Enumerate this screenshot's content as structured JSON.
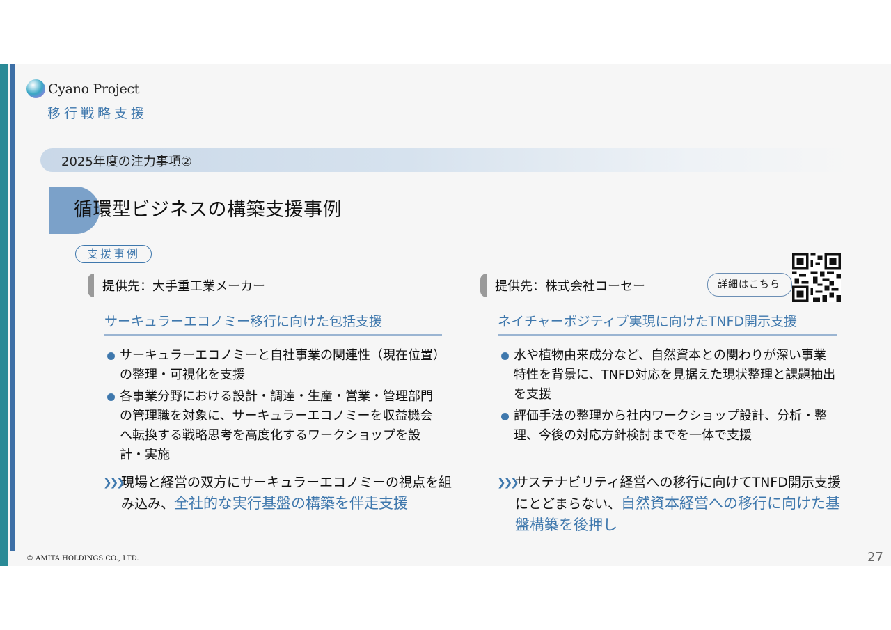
{
  "header": {
    "logo_text": "Cyano Project",
    "subtitle": "移行戦略支援"
  },
  "banner": {
    "text": "2025年度の注力事項②"
  },
  "title": "循環型ビジネスの構築支援事例",
  "section_pill": "支援事例",
  "left": {
    "client": "提供先：大手重工業メーカー",
    "heading": "サーキュラーエコノミー移行に向けた包括支援",
    "bullets": [
      "サーキュラーエコノミーと自社事業の関連性（現在位置）の整理・可視化を支援",
      "各事業分野における設計・調達・生産・営業・管理部門の管理職を対象に、サーキュラーエコノミーを収益機会へ転換する戦略思考を高度化するワークショップを設計・実施"
    ],
    "summary_plain": "現場と経営の双方にサーキュラーエコノミーの視点を組み込み、",
    "summary_highlight": "全社的な実行基盤の構築を伴走支援"
  },
  "right": {
    "client": "提供先：株式会社コーセー",
    "heading": "ネイチャーポジティブ実現に向けたTNFD開示支援",
    "bullets": [
      "水や植物由来成分など、自然資本との関わりが深い事業特性を背景に、TNFD対応を見据えた現状整理と課題抽出を支援",
      "評価手法の整理から社内ワークショップ設計、分析・整理、今後の対応方針検討までを一体で支援"
    ],
    "summary_plain": "サステナビリティ経営への移行に向けてTNFD開示支援にとどまらない、",
    "summary_highlight": "自然資本経営への移行に向けた基盤構築を後押し",
    "detail_link": "詳細はこちら"
  },
  "footer": {
    "copyright": "© AMITA HOLDINGS CO., LTD.",
    "page_number": "27"
  },
  "colors": {
    "accent_blue": "#3f78ad",
    "teal_bar": "#2a8a96",
    "title_tab": "#7ba1c9"
  }
}
